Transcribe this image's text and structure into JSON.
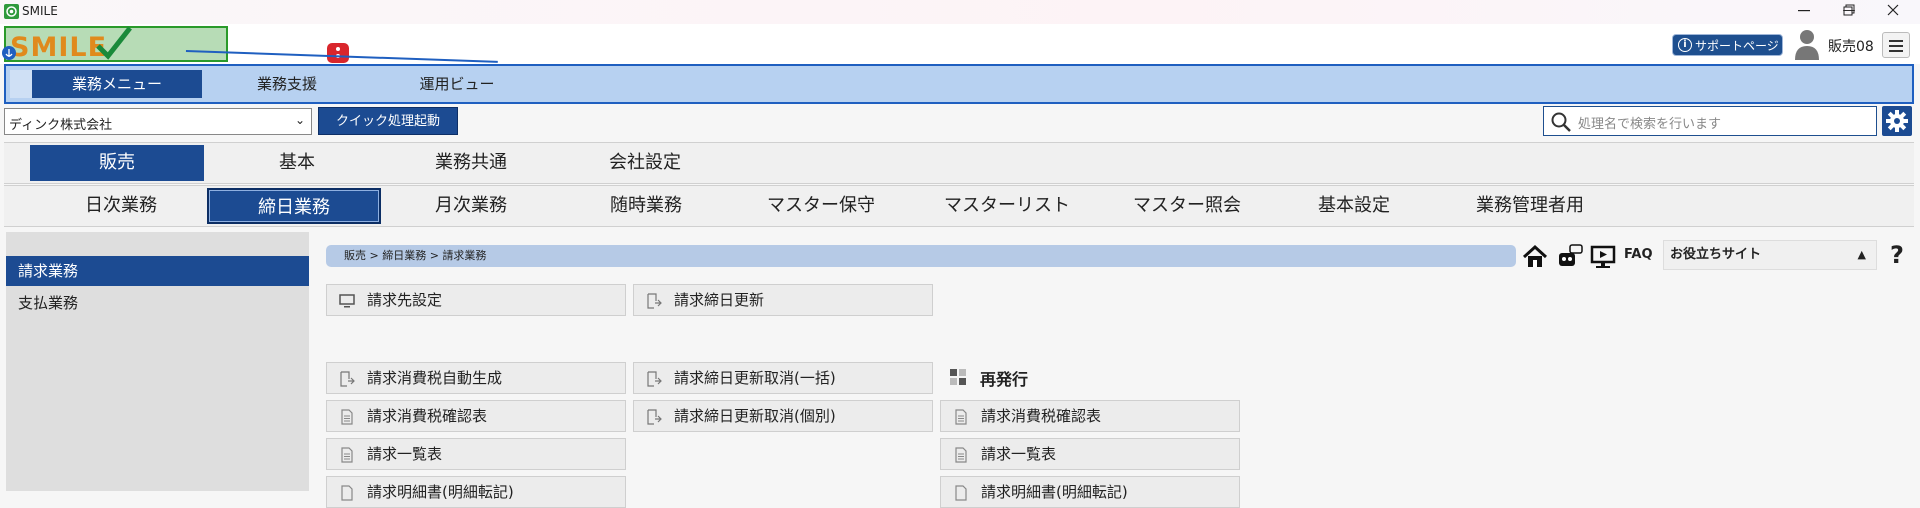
{
  "window": {
    "title": "SMILE"
  },
  "header": {
    "logo_text": "SMILE",
    "support_label": "サポートページ",
    "user_name": "販売08"
  },
  "menubar": {
    "tabs": [
      {
        "label": "業務メニュー",
        "active": true
      },
      {
        "label": "業務支援",
        "active": false
      },
      {
        "label": "運用ビュー",
        "active": false
      }
    ]
  },
  "toolbar": {
    "company": "ディンク株式会社",
    "quick_label": "クイック処理起動",
    "search_placeholder": "処理名で検索を行います"
  },
  "categories": [
    {
      "label": "販売",
      "active": true
    },
    {
      "label": "基本",
      "active": false
    },
    {
      "label": "業務共通",
      "active": false
    },
    {
      "label": "会社設定",
      "active": false
    }
  ],
  "subcategories": [
    {
      "label": "日次業務",
      "active": false
    },
    {
      "label": "締日業務",
      "active": true
    },
    {
      "label": "月次業務",
      "active": false
    },
    {
      "label": "随時業務",
      "active": false
    },
    {
      "label": "マスター保守",
      "active": false
    },
    {
      "label": "マスターリスト",
      "active": false
    },
    {
      "label": "マスター照会",
      "active": false
    },
    {
      "label": "基本設定",
      "active": false
    },
    {
      "label": "業務管理者用",
      "active": false
    }
  ],
  "sidebar": {
    "items": [
      {
        "label": "請求業務",
        "active": true
      },
      {
        "label": "支払業務",
        "active": false
      }
    ]
  },
  "main": {
    "breadcrumb": "販売 > 締日業務 > 請求業務",
    "faq_label": "FAQ",
    "useful_label": "お役立ちサイト",
    "help_label": "?",
    "tiles_row1": [
      {
        "label": "請求先設定",
        "icon": "monitor-icon"
      },
      {
        "label": "請求締日更新",
        "icon": "process-icon"
      }
    ],
    "col1": [
      {
        "label": "請求消費税自動生成",
        "icon": "process-icon"
      },
      {
        "label": "請求消費税確認表",
        "icon": "document-icon"
      },
      {
        "label": "請求一覧表",
        "icon": "document-icon"
      },
      {
        "label": "請求明細書(明細転記)",
        "icon": "document-icon"
      }
    ],
    "col2": [
      {
        "label": "請求締日更新取消(一括)",
        "icon": "process-icon"
      },
      {
        "label": "請求締日更新取消(個別)",
        "icon": "process-icon"
      }
    ],
    "group3": {
      "title": "再発行",
      "items": [
        {
          "label": "請求消費税確認表",
          "icon": "document-icon"
        },
        {
          "label": "請求一覧表",
          "icon": "document-icon"
        },
        {
          "label": "請求明細書(明細転記)",
          "icon": "document-icon"
        }
      ]
    }
  }
}
